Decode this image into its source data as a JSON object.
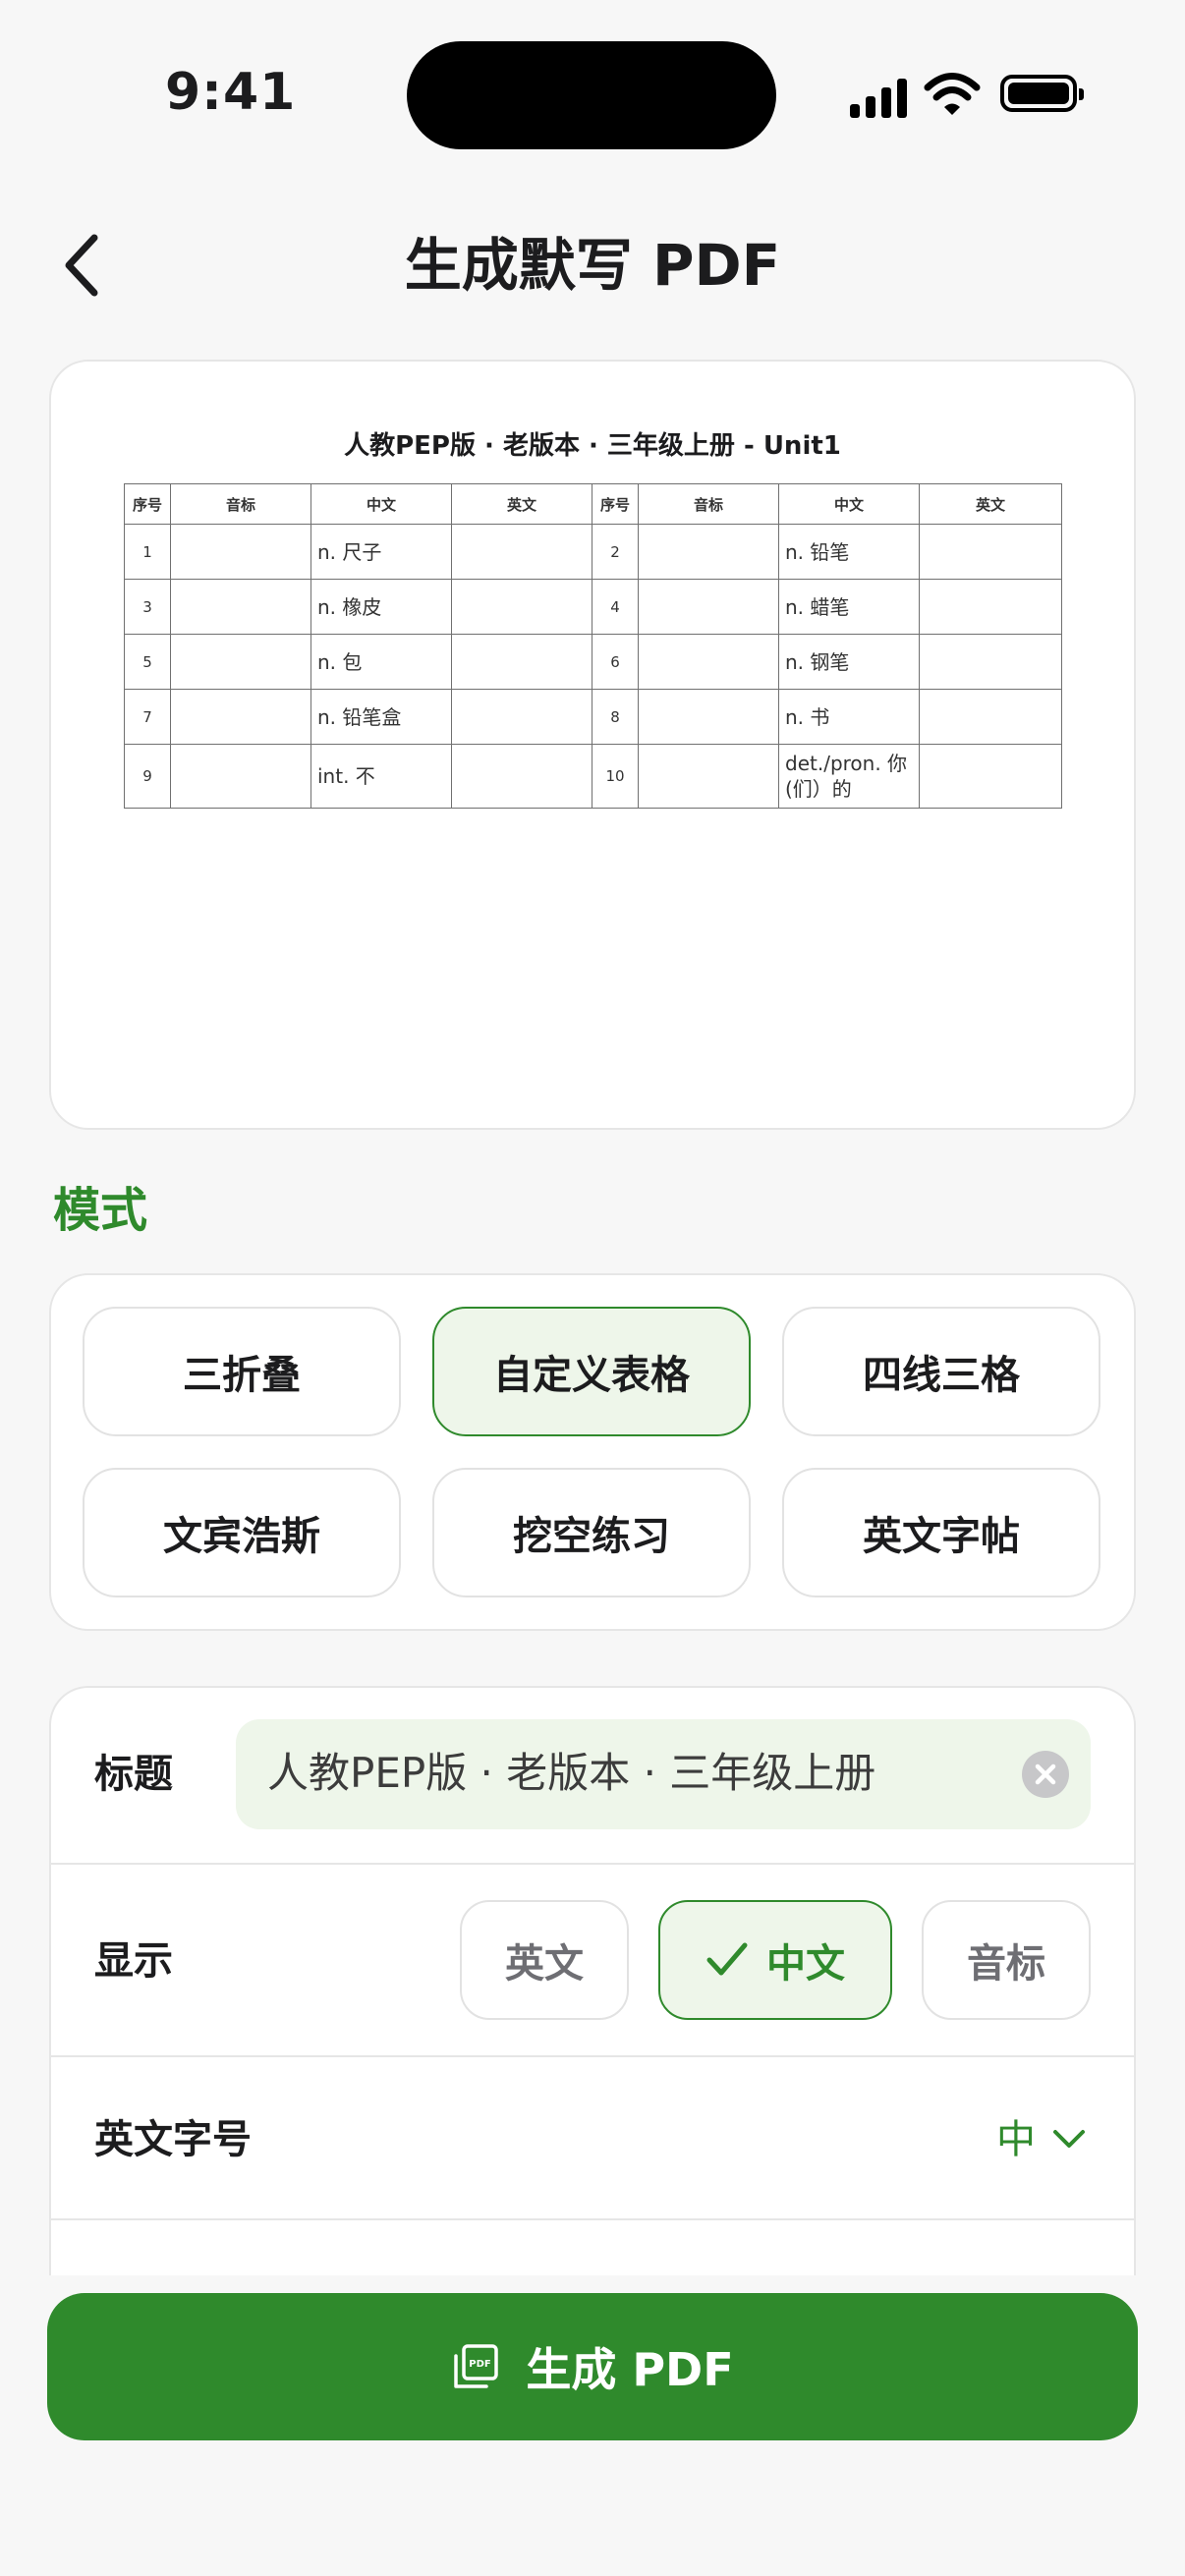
{
  "status_bar": {
    "time": "9:41"
  },
  "nav": {
    "title": "生成默写 PDF"
  },
  "preview": {
    "sheet_title": "人教PEP版 · 老版本 · 三年级上册 - Unit1",
    "headers": [
      "序号",
      "音标",
      "中文",
      "英文",
      "序号",
      "音标",
      "中文",
      "英文"
    ],
    "rows": [
      {
        "no_left": "1",
        "cn_left": "n. 尺子",
        "no_right": "2",
        "cn_right": "n. 铅笔"
      },
      {
        "no_left": "3",
        "cn_left": "n. 橡皮",
        "no_right": "4",
        "cn_right": "n. 蜡笔"
      },
      {
        "no_left": "5",
        "cn_left": "n. 包",
        "no_right": "6",
        "cn_right": "n. 钢笔"
      },
      {
        "no_left": "7",
        "cn_left": "n. 铅笔盒",
        "no_right": "8",
        "cn_right": "n. 书"
      },
      {
        "no_left": "9",
        "cn_left": "int. 不",
        "no_right": "10",
        "cn_right": "det./pron. 你(们）的"
      }
    ]
  },
  "mode": {
    "label": "模式",
    "options": [
      "三折叠",
      "自定义表格",
      "四线三格",
      "文宾浩斯",
      "挖空练习",
      "英文字帖"
    ],
    "selected": "自定义表格"
  },
  "settings": {
    "title_label": "标题",
    "title_value": "人教PEP版 · 老版本 · 三年级上册",
    "display_label": "显示",
    "display_options": [
      "英文",
      "中文",
      "音标"
    ],
    "display_selected": "中文",
    "font_size_label": "英文字号",
    "font_size_value": "中"
  },
  "generate_button": {
    "label": "生成 PDF",
    "icon": "pdf-icon"
  },
  "colors": {
    "accent": "#2f8a2c",
    "accent_light": "#eef6ea"
  }
}
